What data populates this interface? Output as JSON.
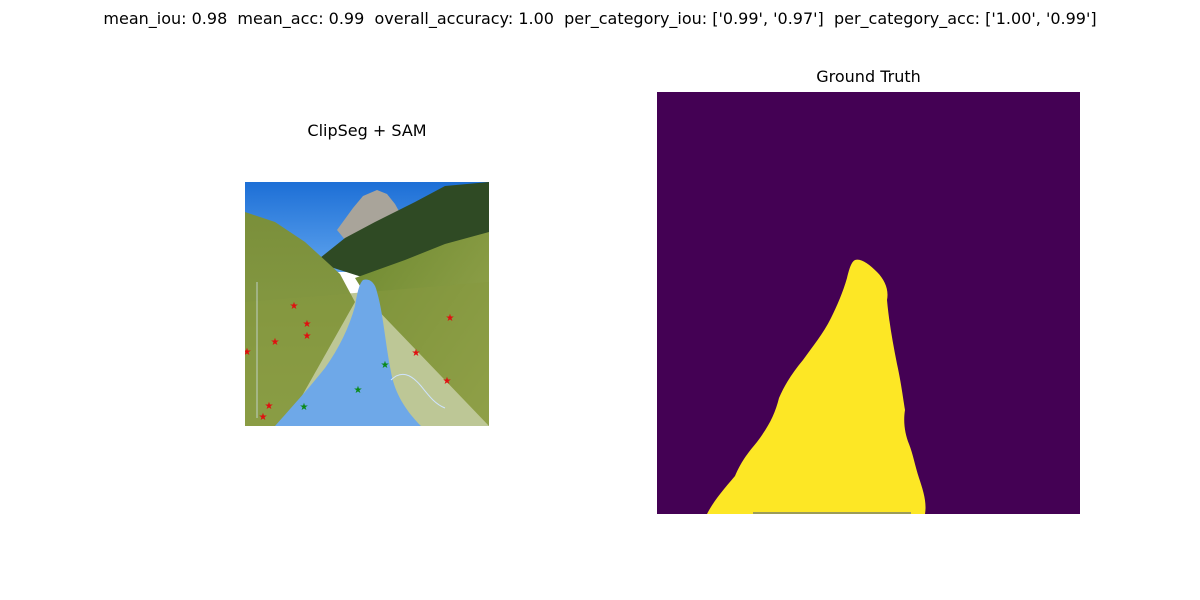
{
  "metrics_line": "mean_iou: 0.98  mean_acc: 0.99  overall_accuracy: 1.00  per_category_iou: ['0.99', '0.97']  per_category_acc: ['1.00', '0.99']",
  "panels": {
    "left": {
      "title": "ClipSeg + SAM"
    },
    "right": {
      "title": "Ground Truth"
    }
  },
  "colors": {
    "mask_background": "#440154",
    "mask_foreground": "#fde725",
    "overlay_path": "#6ea8e8",
    "positive_point": "#0a8a1a",
    "negative_point": "#e01010"
  }
}
